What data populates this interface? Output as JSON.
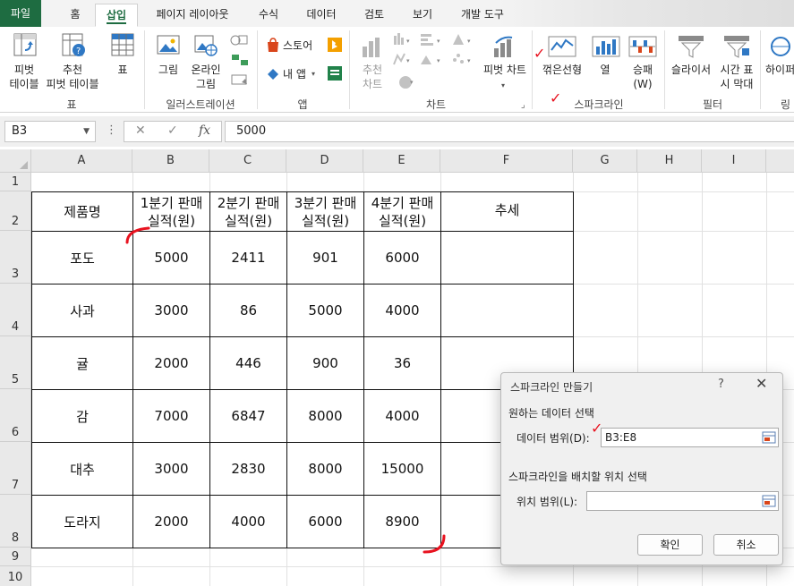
{
  "ribbon_tabs": [
    "파일",
    "홈",
    "삽입",
    "페이지 레이아웃",
    "수식",
    "데이터",
    "검토",
    "보기",
    "개발 도구"
  ],
  "ribbon": {
    "pivot_table": {
      "l1": "피벗",
      "l2": "테이블"
    },
    "recommended_pivot": {
      "l1": "추천",
      "l2": "피벗 테이블"
    },
    "table": "표",
    "group_table": "표",
    "picture": "그림",
    "online_picture": {
      "l1": "온라인",
      "l2": "그림"
    },
    "group_illustration": "일러스트레이션",
    "store": "스토어",
    "my_apps": "내 앱",
    "group_apps": "앱",
    "recommended_chart": {
      "l1": "추천",
      "l2": "차트"
    },
    "pivot_chart": "피벗 차트",
    "group_chart": "차트",
    "sparkline_line": "꺾은선형",
    "sparkline_column": "열",
    "sparkline_winloss": {
      "l1": "승패",
      "l2": "(W)"
    },
    "group_sparkline": "스파크라인",
    "slicer": "슬라이서",
    "timeline": {
      "l1": "시간 표",
      "l2": "시 막대"
    },
    "group_filter": "필터",
    "hyperlink": "하이퍼",
    "group_link": "링"
  },
  "formula_bar": {
    "name_box": "B3",
    "fx": "fx",
    "value": "5000"
  },
  "columns": [
    "A",
    "B",
    "C",
    "D",
    "E",
    "F",
    "G",
    "H",
    "I"
  ],
  "rows": [
    "1",
    "2",
    "3",
    "4",
    "5",
    "6",
    "7",
    "8",
    "9",
    "10"
  ],
  "table": {
    "headers": [
      "제품명",
      "1분기 판매\n실적(원)",
      "2분기 판매\n실적(원)",
      "3분기 판매\n실적(원)",
      "4분기 판매\n실적(원)",
      "추세"
    ],
    "rows": [
      [
        "포도",
        "5000",
        "2411",
        "901",
        "6000"
      ],
      [
        "사과",
        "3000",
        "86",
        "5000",
        "4000"
      ],
      [
        "귤",
        "2000",
        "446",
        "900",
        "36"
      ],
      [
        "감",
        "7000",
        "6847",
        "8000",
        "4000"
      ],
      [
        "대추",
        "3000",
        "2830",
        "8000",
        "15000"
      ],
      [
        "도라지",
        "2000",
        "4000",
        "6000",
        "8900"
      ]
    ]
  },
  "dialog": {
    "title": "스파크라인 만들기",
    "help": "?",
    "close": "✕",
    "section_data": "원하는 데이터 선택",
    "data_range_label": "데이터 범위(D):",
    "data_range_value": "B3:E8",
    "section_location": "스파크라인을 배치할 위치 선택",
    "location_label": "위치 범위(L):",
    "location_value": "",
    "ok": "확인",
    "cancel": "취소"
  },
  "colors": {
    "excel_green": "#1e6c41",
    "annotation_red": "#e8121f"
  }
}
